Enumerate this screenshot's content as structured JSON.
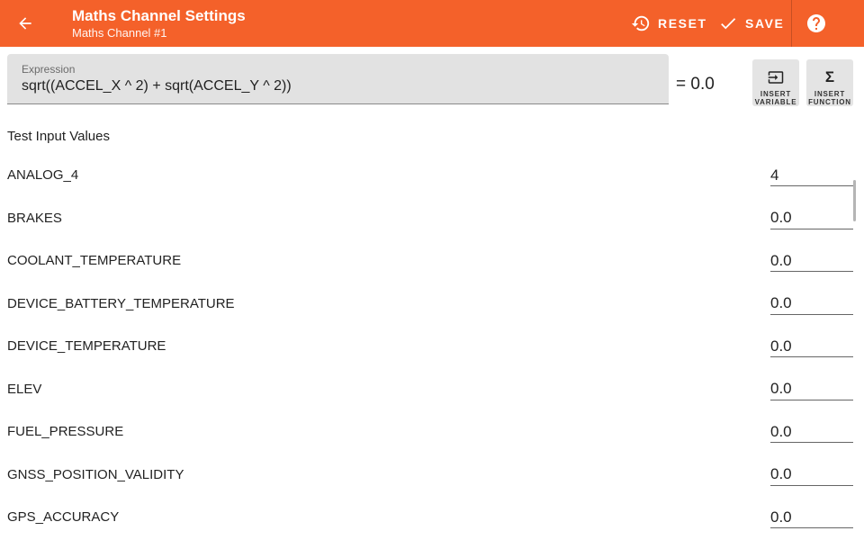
{
  "header": {
    "title": "Maths Channel Settings",
    "subtitle": "Maths Channel #1",
    "back_icon": "arrow-left",
    "reset": {
      "label": "RESET",
      "icon": "history"
    },
    "save": {
      "label": "SAVE",
      "icon": "check"
    },
    "help_icon": "help-circle",
    "background_color": "#f4612a"
  },
  "expression": {
    "label": "Expression",
    "value": "sqrt((ACCEL_X ^ 2) + sqrt(ACCEL_Y ^ 2))",
    "result": "= 0.0"
  },
  "tools": {
    "insert_variable": {
      "label_line1": "INSERT",
      "label_line2": "VARIABLE",
      "icon": "input-arrow"
    },
    "insert_function": {
      "label_line1": "INSERT",
      "label_line2": "FUNCTION",
      "icon": "sigma"
    }
  },
  "test_inputs": {
    "title": "Test Input Values",
    "rows": [
      {
        "name": "ANALOG_4",
        "value": "4"
      },
      {
        "name": "BRAKES",
        "value": "0.0"
      },
      {
        "name": "COOLANT_TEMPERATURE",
        "value": "0.0"
      },
      {
        "name": "DEVICE_BATTERY_TEMPERATURE",
        "value": "0.0"
      },
      {
        "name": "DEVICE_TEMPERATURE",
        "value": "0.0"
      },
      {
        "name": "ELEV",
        "value": "0.0"
      },
      {
        "name": "FUEL_PRESSURE",
        "value": "0.0"
      },
      {
        "name": "GNSS_POSITION_VALIDITY",
        "value": "0.0"
      },
      {
        "name": "GPS_ACCURACY",
        "value": "0.0"
      }
    ]
  }
}
